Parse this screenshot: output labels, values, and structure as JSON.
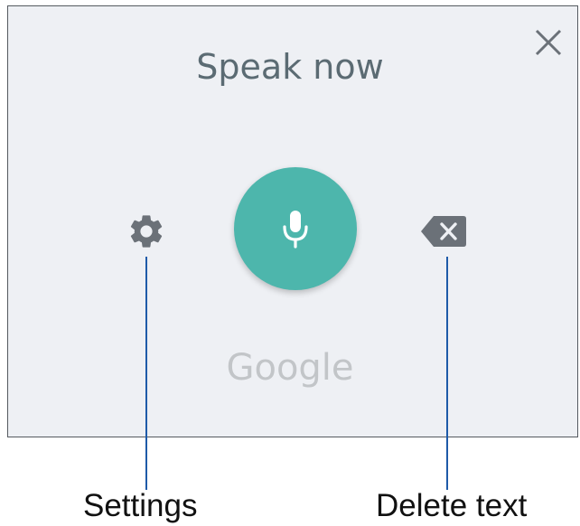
{
  "dialog": {
    "title": "Speak now",
    "brand": "Google",
    "close_icon": "close-icon",
    "mic_icon": "microphone-icon",
    "settings_icon": "gear-icon",
    "delete_icon": "backspace-icon"
  },
  "callouts": {
    "settings_label": "Settings",
    "delete_label": "Delete text"
  },
  "colors": {
    "panel_background": "#eef0f4",
    "accent": "#4db6ac",
    "icon_gray": "#6b7178",
    "title_text": "#5b6b73",
    "callout_line": "#1e5aa8"
  }
}
